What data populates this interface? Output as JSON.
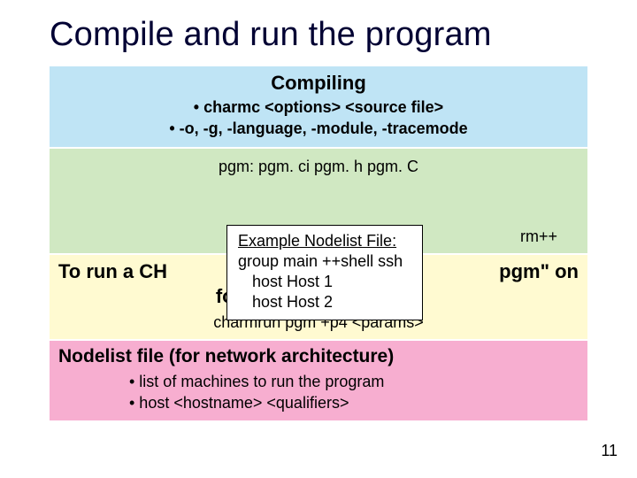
{
  "title": "Compile and run the program",
  "compiling": {
    "heading": "Compiling",
    "b1": "• charmc <options> <source file>",
    "b2": "• -o, -g, -language, -module, -tracemode"
  },
  "makefile": {
    "line1": "pgm: pgm. ci pgm. h pgm. C",
    "partial_right": "rm++"
  },
  "run": {
    "left_fragment": "To run a CH",
    "right_fragment": "pgm\" on",
    "line2": "four processors, type:",
    "cmd": "charmrun pgm +p4 <params>"
  },
  "nodelist_panel": {
    "heading": "Nodelist file (for network architecture)",
    "b1": "• list of machines to run the program",
    "b2": "• host <hostname> <qualifiers>"
  },
  "nodelist_box": {
    "head": "Example Nodelist File:",
    "l1": "group main ++shell ssh",
    "l2": "host Host 1",
    "l3": "host Host 2"
  },
  "page_number": "11"
}
